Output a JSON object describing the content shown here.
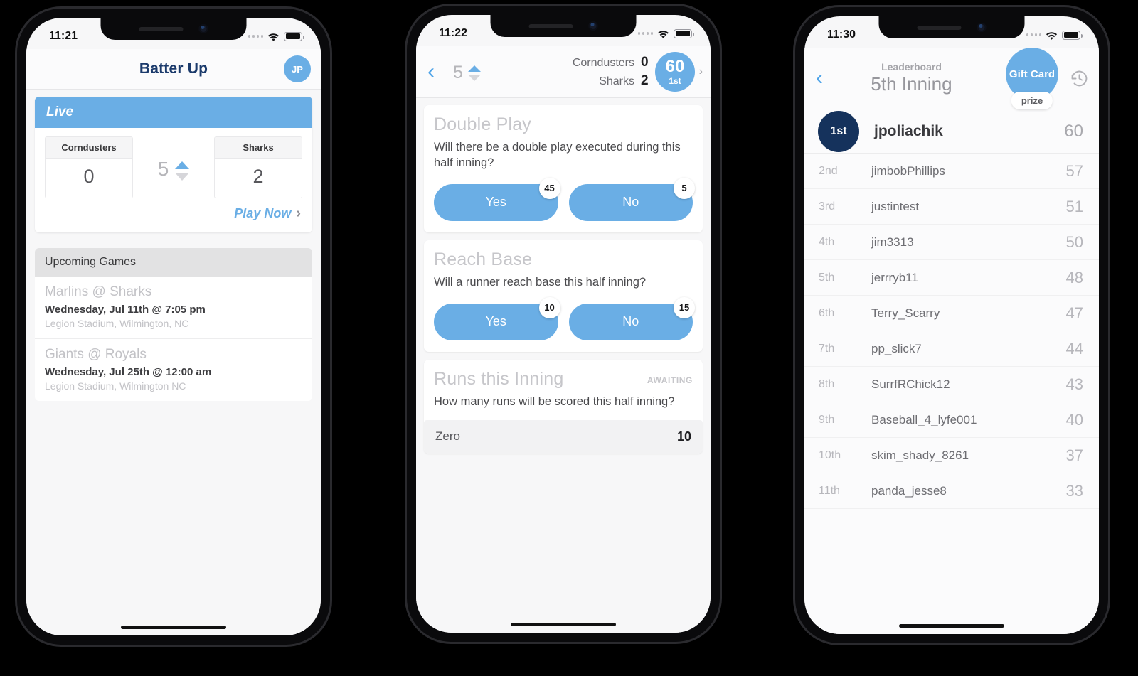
{
  "phone1": {
    "status": {
      "time": "11:21"
    },
    "header": {
      "title": "Batter Up",
      "avatar_initials": "JP"
    },
    "live_card": {
      "live_label": "Live",
      "away_team": "Corndusters",
      "away_score": "0",
      "home_team": "Sharks",
      "home_score": "2",
      "inning": "5",
      "play_now": "Play Now",
      "chevron": "›"
    },
    "upcoming": {
      "header": "Upcoming Games",
      "games": [
        {
          "teams": "Marlins @ Sharks",
          "when": "Wednesday, Jul 11th @ 7:05 pm",
          "where": "Legion Stadium, Wilmington, NC"
        },
        {
          "teams": "Giants @ Royals",
          "when": "Wednesday, Jul 25th @ 12:00 am",
          "where": "Legion Stadium, Wilmington NC"
        }
      ]
    }
  },
  "phone2": {
    "status": {
      "time": "11:22"
    },
    "header": {
      "back": "‹",
      "inning": "5",
      "away_team": "Corndusters",
      "away_score": "0",
      "home_team": "Sharks",
      "home_score": "2",
      "points": "60",
      "place": "1st",
      "badge_chevron": "›"
    },
    "questions": [
      {
        "title": "Double Play",
        "text": "Will there be a double play executed during this half inning?",
        "yes_label": "Yes",
        "yes_count": "45",
        "no_label": "No",
        "no_count": "5"
      },
      {
        "title": "Reach Base",
        "text": "Will a runner reach base this half inning?",
        "yes_label": "Yes",
        "yes_count": "10",
        "no_label": "No",
        "no_count": "15"
      }
    ],
    "runs_card": {
      "title": "Runs this Inning",
      "status": "AWAITING",
      "text": "How many runs will be scored this half inning?",
      "option_label": "Zero",
      "option_value": "10"
    }
  },
  "phone3": {
    "status": {
      "time": "11:30"
    },
    "header": {
      "back": "‹",
      "subtitle": "Leaderboard",
      "title": "5th Inning",
      "prize_label": "Gift Card",
      "prize_tag": "prize"
    },
    "leaderboard": [
      {
        "rank": "1st",
        "name": "jpoliachik",
        "score": "60"
      },
      {
        "rank": "2nd",
        "name": "jimbobPhillips",
        "score": "57"
      },
      {
        "rank": "3rd",
        "name": "justintest",
        "score": "51"
      },
      {
        "rank": "4th",
        "name": "jim3313",
        "score": "50"
      },
      {
        "rank": "5th",
        "name": "jerrryb11",
        "score": "48"
      },
      {
        "rank": "6th",
        "name": "Terry_Scarry",
        "score": "47"
      },
      {
        "rank": "7th",
        "name": "pp_slick7",
        "score": "44"
      },
      {
        "rank": "8th",
        "name": "SurrfRChick12",
        "score": "43"
      },
      {
        "rank": "9th",
        "name": "Baseball_4_lyfe001",
        "score": "40"
      },
      {
        "rank": "10th",
        "name": "skim_shady_8261",
        "score": "37"
      },
      {
        "rank": "11th",
        "name": "panda_jesse8",
        "score": "33"
      }
    ]
  },
  "colors": {
    "accent_blue": "#6aaee5",
    "navy": "#15325c",
    "title_navy": "#1b3a6b"
  }
}
